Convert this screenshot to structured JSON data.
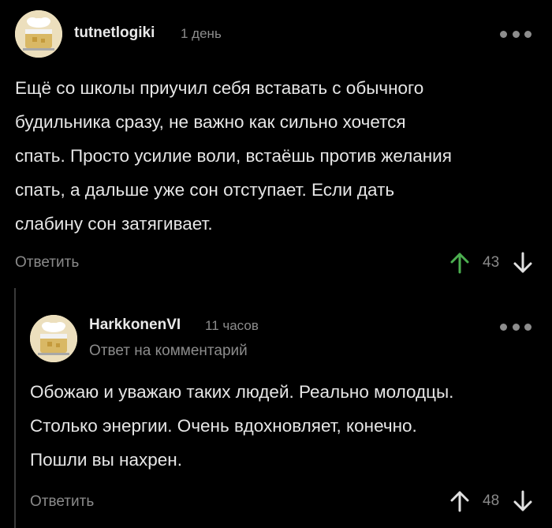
{
  "colors": {
    "background": "#000000",
    "text": "#e6e6e6",
    "muted": "#8a8a8a",
    "upvote_active": "#4caf50",
    "arrow_default": "#e0e0e0"
  },
  "comments": [
    {
      "username": "tutnetlogiki",
      "time": "1 день",
      "reply_to": "",
      "avatar": "default-cake-avatar",
      "body_lines": [
        "Ещё со школы приучил себя вставать с обычного",
        "будильника сразу, не важно как сильно хочется",
        "спать. Просто усилие воли, встаёшь против желания",
        "спать, а дальше уже сон отступает. Если дать",
        "слабину сон затягивает."
      ],
      "reply_label": "Ответить",
      "score": "43",
      "upvoted": true,
      "more_icon": "more-dots-icon"
    },
    {
      "username": "HarkkonenVI",
      "time": "11 часов",
      "reply_to": "Ответ на комментарий",
      "avatar": "default-cake-avatar",
      "body_lines": [
        "Обожаю и уважаю таких людей. Реально молодцы.",
        "Столько энергии. Очень вдохновляет, конечно.",
        "Пошли вы нахрен."
      ],
      "reply_label": "Ответить",
      "score": "48",
      "upvoted": false,
      "more_icon": "more-dots-icon"
    }
  ]
}
